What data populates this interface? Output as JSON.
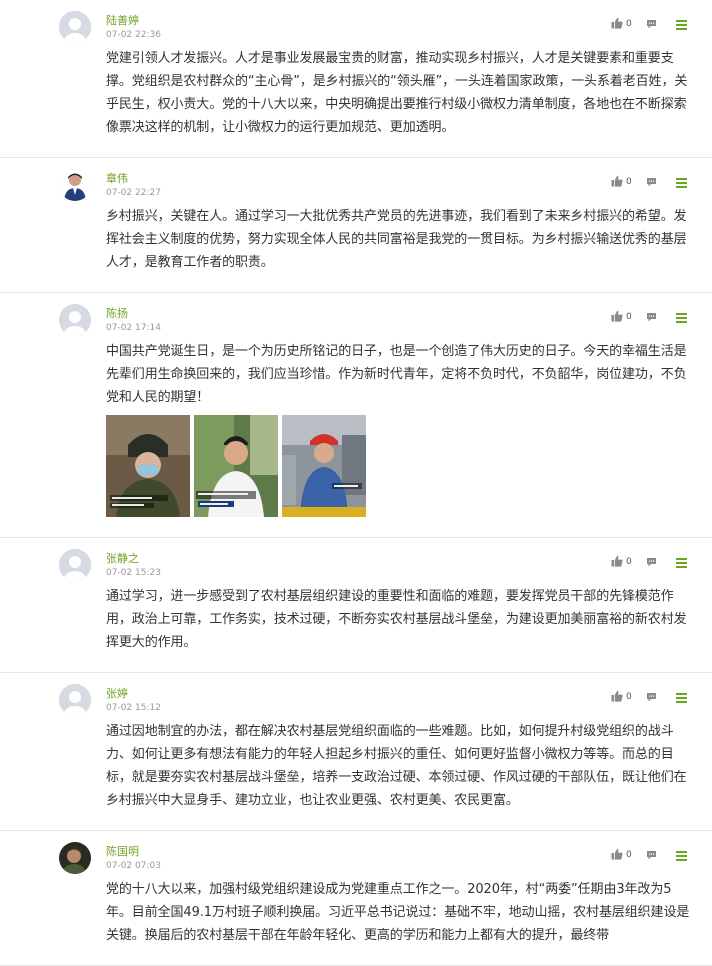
{
  "comments": [
    {
      "author": "陆善婷",
      "time": "07-02 22:36",
      "likes": "0",
      "text": "党建引领人才发振兴。人才是事业发展最宝贵的财富，推动实现乡村振兴，人才是关键要素和重要支撑。党组织是农村群众的“主心骨”，是乡村振兴的“领头雁”，一头连着国家政策，一头系着老百姓，关乎民生，权小责大。党的十八大以来，中央明确提出要推行村级小微权力清单制度，各地也在不断探索像票决这样的机制，让小微权力的运行更加规范、更加透明。",
      "avatar": "default-avatar"
    },
    {
      "author": "章伟",
      "time": "07-02 22:27",
      "likes": "0",
      "text": "乡村振兴，关键在人。通过学习一大批优秀共产党员的先进事迹，我们看到了未来乡村振兴的希望。发挥社会主义制度的优势，努力实现全体人民的共同富裕是我党的一贯目标。为乡村振兴输送优秀的基层人才，是教育工作者的职责。",
      "avatar": "photo-avatar"
    },
    {
      "author": "陈扬",
      "time": "07-02 17:14",
      "likes": "0",
      "text": "中国共产党诞生日，是一个为历史所铭记的日子，也是一个创造了伟大历史的日子。今天的幸福生活是先辈们用生命换回来的，我们应当珍惜。作为新时代青年，定将不负时代，不负韶华，岗位建功，不负党和人民的期望！",
      "avatar": "default-avatar",
      "photos": [
        "news-still-firefighter",
        "news-still-young-man",
        "news-still-worker"
      ]
    },
    {
      "author": "张静之",
      "time": "07-02 15:23",
      "likes": "0",
      "text": "通过学习，进一步感受到了农村基层组织建设的重要性和面临的难题，要发挥党员干部的先锋模范作用，政治上可靠，工作务实，技术过硬，不断夯实农村基层战斗堡垒，为建设更加美丽富裕的新农村发挥更大的作用。",
      "avatar": "default-avatar"
    },
    {
      "author": "张婷",
      "time": "07-02 15:12",
      "likes": "0",
      "text": "通过因地制宜的办法，都在解决农村基层党组织面临的一些难题。比如，如何提升村级党组织的战斗力、如何让更多有想法有能力的年轻人担起乡村振兴的重任、如何更好监督小微权力等等。而总的目标，就是要夯实农村基层战斗堡垒，培养一支政治过硬、本领过硬、作风过硬的干部队伍，既让他们在乡村振兴中大显身手、建功立业，也让农业更强、农村更美、农民更富。",
      "avatar": "default-avatar"
    },
    {
      "author": "陈国明",
      "time": "07-02 07:03",
      "likes": "0",
      "text": "党的十八大以来，加强村级党组织建设成为党建重点工作之一。2020年，村“两委”任期由3年改为5年。目前全国49.1万村班子顺利换届。习近平总书记说过：基础不牢，地动山摇，农村基层组织建设是关键。换届后的农村基层干部在年龄年轻化、更高的学历和能力上都有大的提升，最终带",
      "avatar": "photo-avatar-dark"
    }
  ],
  "colors": {
    "author": "#6fa326",
    "menu": "#6fa326",
    "divider": "#e6e6e6"
  },
  "icons": {
    "like": "thumbs-up-icon",
    "reply": "comment-icon",
    "menu": "menu-icon"
  }
}
